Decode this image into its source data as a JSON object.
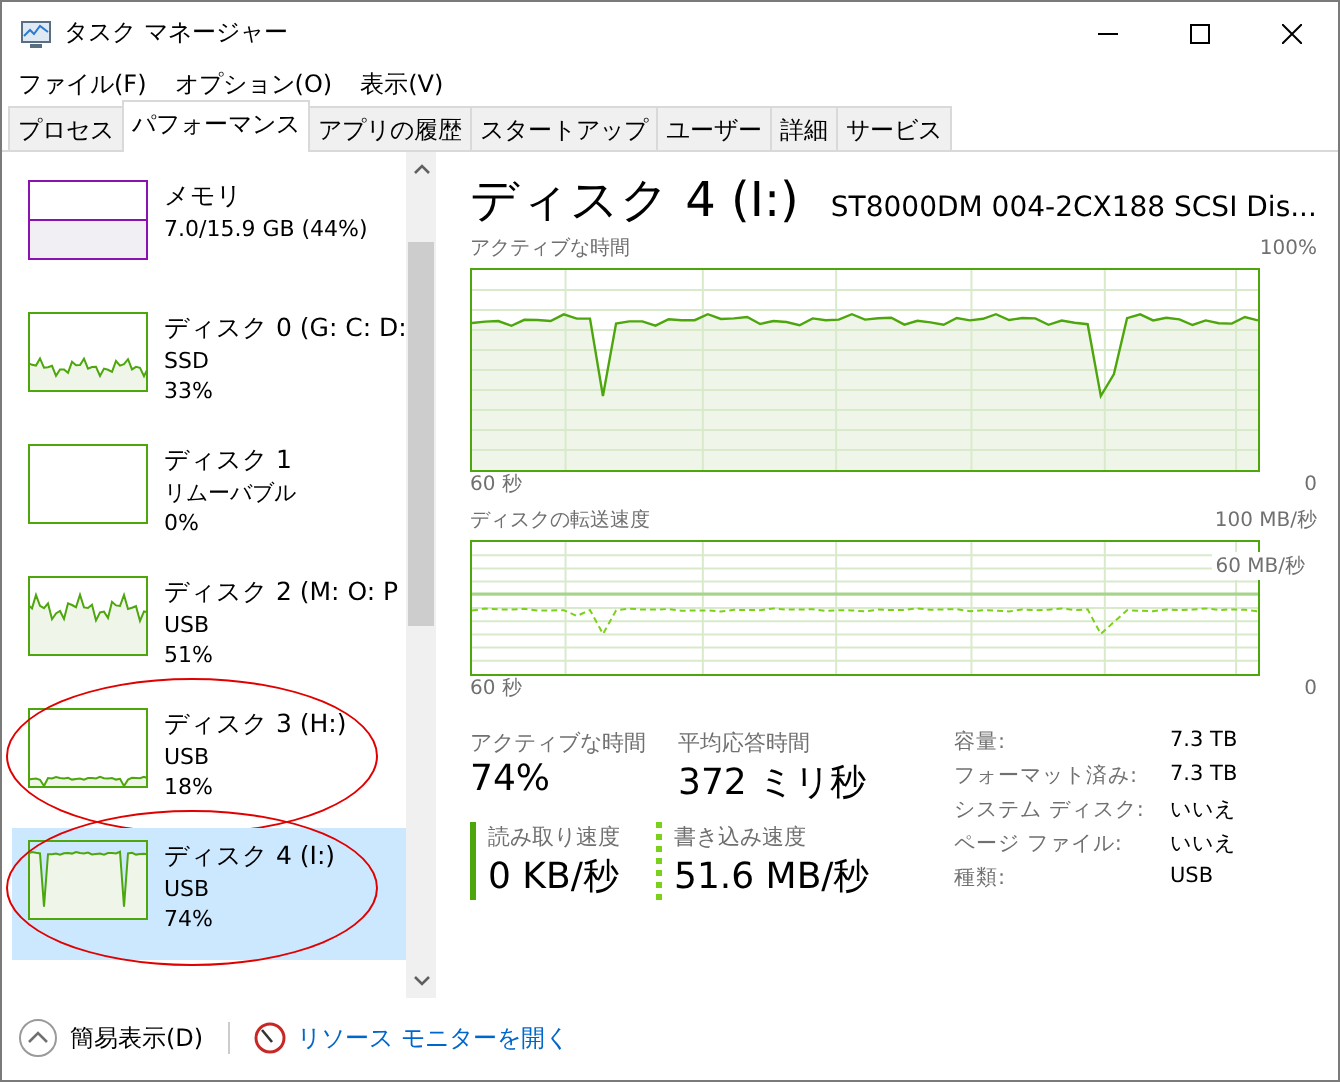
{
  "window": {
    "title": "タスク マネージャー"
  },
  "menu": [
    "ファイル(F)",
    "オプション(O)",
    "表示(V)"
  ],
  "tabs": [
    {
      "label": "プロセス",
      "selected": false
    },
    {
      "label": "パフォーマンス",
      "selected": true
    },
    {
      "label": "アプリの履歴",
      "selected": false
    },
    {
      "label": "スタートアップ",
      "selected": false
    },
    {
      "label": "ユーザー",
      "selected": false
    },
    {
      "label": "詳細",
      "selected": false
    },
    {
      "label": "サービス",
      "selected": false
    }
  ],
  "sidebar": {
    "items": [
      {
        "kind": "memory",
        "title": "メモリ",
        "subtitle": "7.0/15.9 GB (44%)",
        "selected": false,
        "circled": false
      },
      {
        "kind": "noisy",
        "title": "ディスク 0 (G: C: D:",
        "subtitle": "SSD",
        "value": "33%",
        "selected": false,
        "circled": false
      },
      {
        "kind": "idle",
        "title": "ディスク 1",
        "subtitle": "リムーバブル",
        "value": "0%",
        "selected": false,
        "circled": false
      },
      {
        "kind": "busy",
        "title": "ディスク 2 (M: O: P",
        "subtitle": "USB",
        "value": "51%",
        "selected": false,
        "circled": false
      },
      {
        "kind": "low",
        "title": "ディスク 3 (H:)",
        "subtitle": "USB",
        "value": "18%",
        "selected": false,
        "circled": true
      },
      {
        "kind": "high",
        "title": "ディスク 4 (I:)",
        "subtitle": "USB",
        "value": "74%",
        "selected": true,
        "circled": true
      }
    ]
  },
  "detail": {
    "title": "ディスク 4 (I:)",
    "model": "ST8000DM 004-2CX188 SCSI Dis...",
    "graphs": [
      {
        "kind": "activity",
        "label": "アクティブな時間",
        "max": "100%",
        "time": "60 秒",
        "zero": "0"
      },
      {
        "kind": "transfer",
        "label": "ディスクの転送速度",
        "max": "100 MB/秒",
        "mark": "60 MB/秒",
        "time": "60 秒",
        "zero": "0"
      }
    ],
    "stats": [
      {
        "label": "アクティブな時間",
        "value": "74%"
      },
      {
        "label": "平均応答時間",
        "value": "372 ミリ秒"
      }
    ],
    "rates": [
      {
        "kind": "solid",
        "label": "読み取り速度",
        "value": "0 KB/秒"
      },
      {
        "kind": "dotted",
        "label": "書き込み速度",
        "value": "51.6 MB/秒"
      }
    ],
    "properties": [
      {
        "name": "容量:",
        "value": "7.3 TB"
      },
      {
        "name": "フォーマット済み:",
        "value": "7.3 TB"
      },
      {
        "name": "システム ディスク:",
        "value": "いいえ"
      },
      {
        "name": "ページ ファイル:",
        "value": "いいえ"
      },
      {
        "name": "種類:",
        "value": "USB"
      }
    ]
  },
  "footer": {
    "compact": "簡易表示(D)",
    "link": "リソース モニターを開く"
  }
}
